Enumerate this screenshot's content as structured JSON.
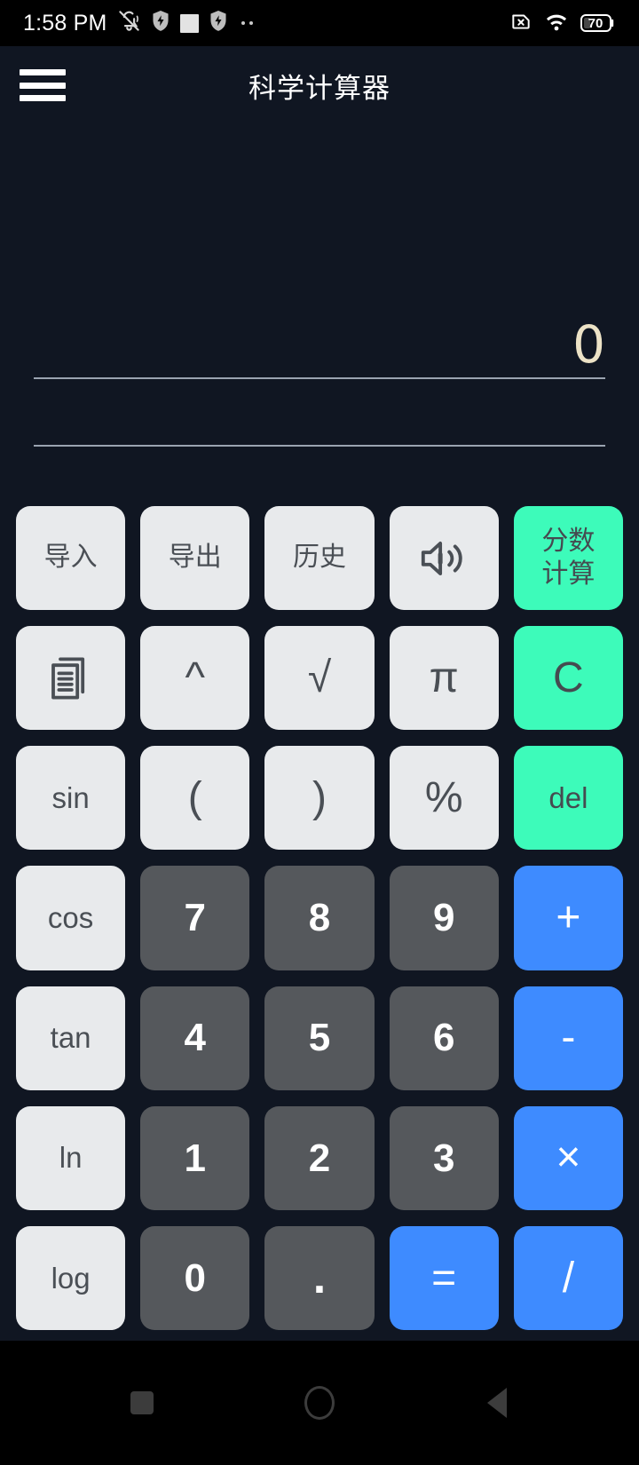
{
  "status_bar": {
    "time": "1:58 PM",
    "left_icons": [
      "bell-muted-icon",
      "shield-bolt-icon",
      "white-square-icon",
      "shield-bolt-icon",
      "overflow-dots-icon"
    ],
    "right_icons": [
      "no-sim-icon",
      "wifi-icon",
      "battery-icon"
    ],
    "battery_level": "70"
  },
  "app_bar": {
    "menu_icon": "hamburger-menu-icon",
    "title": "科学计算器"
  },
  "display": {
    "value": "0",
    "value_color": "#ece2c6",
    "rule_color": "#9aa3b0"
  },
  "colors": {
    "background": "#101622",
    "function_key": "#e8eaec",
    "function_text": "#4a4f55",
    "number_key": "#55585c",
    "number_text": "#ffffff",
    "accent_green": "#3dfbba",
    "accent_blue": "#3e8bff"
  },
  "keypad": {
    "rows": [
      [
        {
          "label": "导入",
          "style": "fn",
          "kind": "text",
          "name": "import"
        },
        {
          "label": "导出",
          "style": "fn",
          "kind": "text",
          "name": "export"
        },
        {
          "label": "历史",
          "style": "fn",
          "kind": "text",
          "name": "history"
        },
        {
          "label": "",
          "style": "fn",
          "kind": "icon",
          "icon": "speaker-volume-icon",
          "name": "sound"
        },
        {
          "label": "分数\n计算",
          "style": "grn",
          "kind": "text2",
          "line1": "分数",
          "line2": "计算",
          "name": "fraction-calc"
        }
      ],
      [
        {
          "label": "",
          "style": "fn",
          "kind": "icon",
          "icon": "copy-documents-icon",
          "name": "copy"
        },
        {
          "label": "^",
          "style": "fn",
          "kind": "text",
          "name": "power"
        },
        {
          "label": "√",
          "style": "fn",
          "kind": "text",
          "name": "sqrt"
        },
        {
          "label": "π",
          "style": "fn",
          "kind": "text",
          "name": "pi"
        },
        {
          "label": "C",
          "style": "grn",
          "kind": "text",
          "name": "clear"
        }
      ],
      [
        {
          "label": "sin",
          "style": "fn",
          "kind": "text",
          "name": "sin"
        },
        {
          "label": "(",
          "style": "fn",
          "kind": "text",
          "name": "paren-open"
        },
        {
          "label": ")",
          "style": "fn",
          "kind": "text",
          "name": "paren-close"
        },
        {
          "label": "%",
          "style": "fn",
          "kind": "text",
          "name": "percent"
        },
        {
          "label": "del",
          "style": "grn",
          "kind": "text",
          "name": "delete"
        }
      ],
      [
        {
          "label": "cos",
          "style": "fn",
          "kind": "text",
          "name": "cos"
        },
        {
          "label": "7",
          "style": "num",
          "kind": "text",
          "name": "digit-7"
        },
        {
          "label": "8",
          "style": "num",
          "kind": "text",
          "name": "digit-8"
        },
        {
          "label": "9",
          "style": "num",
          "kind": "text",
          "name": "digit-9"
        },
        {
          "label": "+",
          "style": "blu",
          "kind": "text",
          "name": "plus"
        }
      ],
      [
        {
          "label": "tan",
          "style": "fn",
          "kind": "text",
          "name": "tan"
        },
        {
          "label": "4",
          "style": "num",
          "kind": "text",
          "name": "digit-4"
        },
        {
          "label": "5",
          "style": "num",
          "kind": "text",
          "name": "digit-5"
        },
        {
          "label": "6",
          "style": "num",
          "kind": "text",
          "name": "digit-6"
        },
        {
          "label": "-",
          "style": "blu",
          "kind": "text",
          "name": "minus"
        }
      ],
      [
        {
          "label": "ln",
          "style": "fn",
          "kind": "text",
          "name": "ln"
        },
        {
          "label": "1",
          "style": "num",
          "kind": "text",
          "name": "digit-1"
        },
        {
          "label": "2",
          "style": "num",
          "kind": "text",
          "name": "digit-2"
        },
        {
          "label": "3",
          "style": "num",
          "kind": "text",
          "name": "digit-3"
        },
        {
          "label": "×",
          "style": "blu",
          "kind": "text",
          "name": "multiply"
        }
      ],
      [
        {
          "label": "log",
          "style": "fn",
          "kind": "text",
          "name": "log"
        },
        {
          "label": "0",
          "style": "num",
          "kind": "text",
          "name": "digit-0"
        },
        {
          "label": ".",
          "style": "num",
          "kind": "text",
          "name": "decimal-point"
        },
        {
          "label": "=",
          "style": "blu",
          "kind": "text",
          "name": "equals"
        },
        {
          "label": "/",
          "style": "blu",
          "kind": "text",
          "name": "divide"
        }
      ]
    ]
  },
  "nav_bar": {
    "buttons": [
      {
        "name": "recents-square-icon"
      },
      {
        "name": "home-circle-icon"
      },
      {
        "name": "back-triangle-icon"
      }
    ]
  }
}
